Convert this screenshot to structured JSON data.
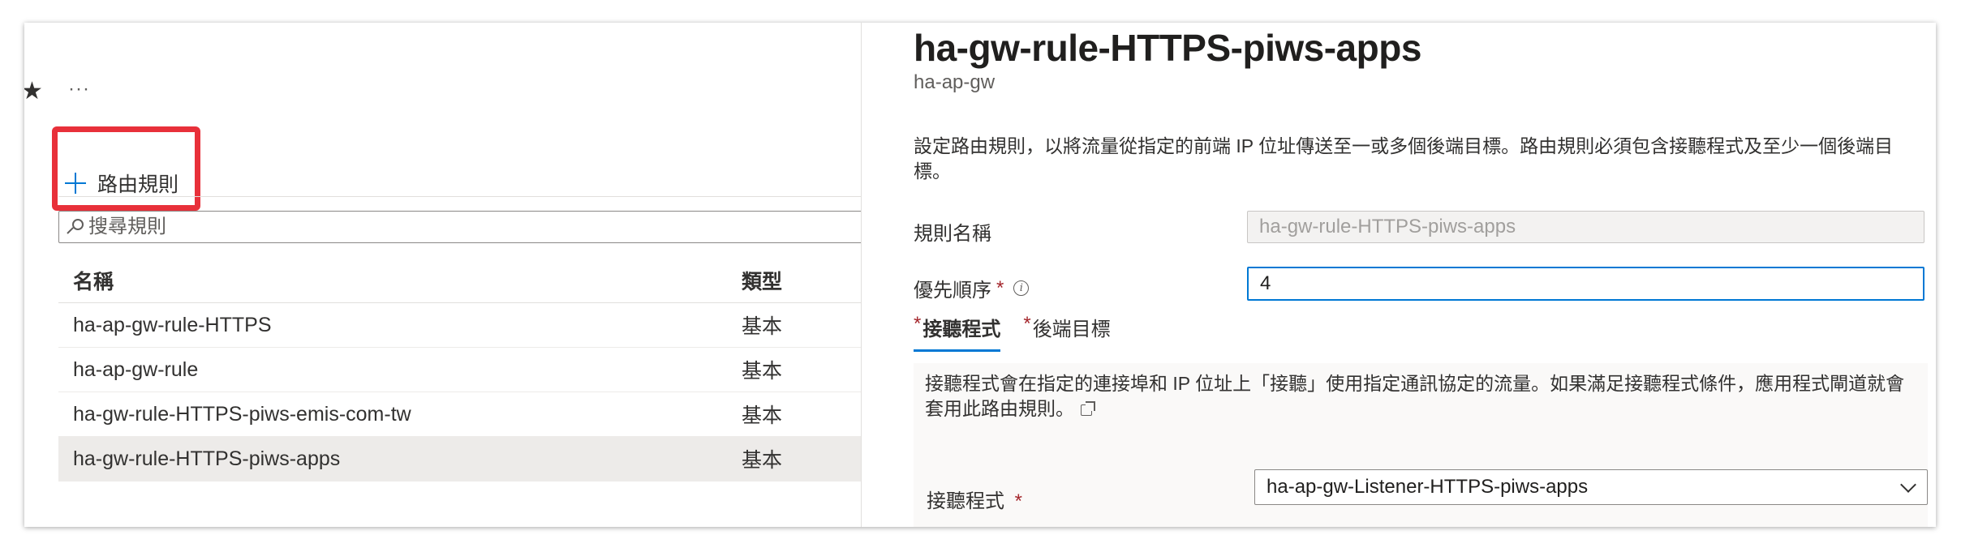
{
  "left": {
    "more_label": "···",
    "add_rule_label": "路由規則",
    "search_placeholder": "搜尋規則",
    "columns": {
      "name": "名稱",
      "type": "類型"
    },
    "rows": [
      {
        "name": "ha-ap-gw-rule-HTTPS",
        "type": "基本"
      },
      {
        "name": "ha-ap-gw-rule",
        "type": "基本"
      },
      {
        "name": "ha-gw-rule-HTTPS-piws-emis-com-tw",
        "type": "基本"
      },
      {
        "name": "ha-gw-rule-HTTPS-piws-apps",
        "type": "基本"
      }
    ],
    "selected_row": 3
  },
  "panel": {
    "title": "ha-gw-rule-HTTPS-piws-apps",
    "subtitle": "ha-ap-gw",
    "description": "設定路由規則，以將流量從指定的前端 IP 位址傳送至一或多個後端目標。路由規則必須包含接聽程式及至少一個後端目標。",
    "rule_name_label": "規則名稱",
    "rule_name_value": "ha-gw-rule-HTTPS-piws-apps",
    "priority_label": "優先順序",
    "priority_value": "4",
    "required_mark": "*",
    "tabs": [
      {
        "label": "接聽程式",
        "active": true
      },
      {
        "label": "後端目標",
        "active": false
      }
    ],
    "listener_description": "接聽程式會在指定的連接埠和 IP 位址上「接聽」使用指定通訊協定的流量。如果滿足接聽程式條件，應用程式閘道就會套用此路由規則。",
    "listener_label": "接聽程式",
    "listener_value": "ha-ap-gw-Listener-HTTPS-piws-apps"
  },
  "colors": {
    "accent": "#0078d4",
    "highlight_border": "#e8303a",
    "required": "#a4262c",
    "selected_row": "#edebe9"
  },
  "icons": [
    "favorite-star-icon",
    "plus-icon",
    "search-icon",
    "info-icon",
    "external-link-icon",
    "chevron-down-icon"
  ]
}
